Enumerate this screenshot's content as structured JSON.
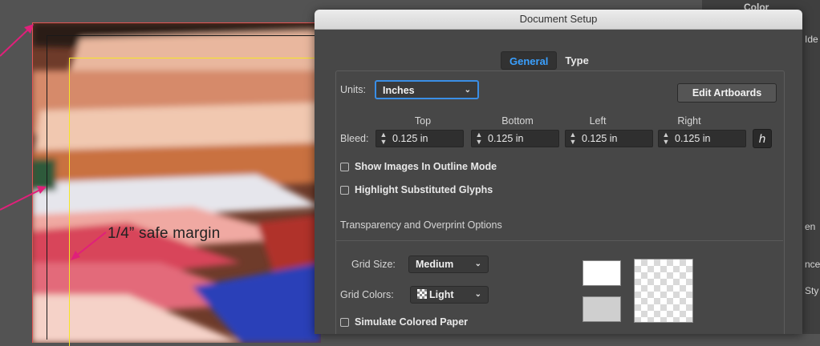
{
  "dialog": {
    "title": "Document Setup",
    "tabs": [
      {
        "label": "General",
        "active": true
      },
      {
        "label": "Type",
        "active": false
      }
    ],
    "units": {
      "label": "Units:",
      "value": "Inches"
    },
    "edit_artboards_label": "Edit Artboards",
    "bleed": {
      "label": "Bleed:",
      "columns": [
        {
          "header": "Top",
          "value": "0.125 in"
        },
        {
          "header": "Bottom",
          "value": "0.125 in"
        },
        {
          "header": "Left",
          "value": "0.125 in"
        },
        {
          "header": "Right",
          "value": "0.125 in"
        }
      ]
    },
    "checkboxes": [
      {
        "label": "Show Images In Outline Mode",
        "checked": false
      },
      {
        "label": "Highlight Substituted Glyphs",
        "checked": false
      }
    ],
    "transparency_section_title": "Transparency and Overprint Options",
    "grid_size": {
      "label": "Grid Size:",
      "value": "Medium"
    },
    "grid_colors": {
      "label": "Grid Colors:",
      "value": "Light"
    },
    "simulate_paper": {
      "label": "Simulate Colored Paper",
      "checked": false
    }
  },
  "canvas": {
    "annotation": "1/4” safe margin"
  },
  "right_panel": {
    "partial_labels": [
      "Color",
      "Ide",
      "en",
      "nce",
      "Sty"
    ]
  },
  "colors": {
    "bleed_line": "#e25555",
    "safe_margin_line": "#f5e623",
    "annotation_arrow": "#e0207a",
    "active_tab_text": "#3aa0ff",
    "focus_ring": "#3a8ee6"
  }
}
